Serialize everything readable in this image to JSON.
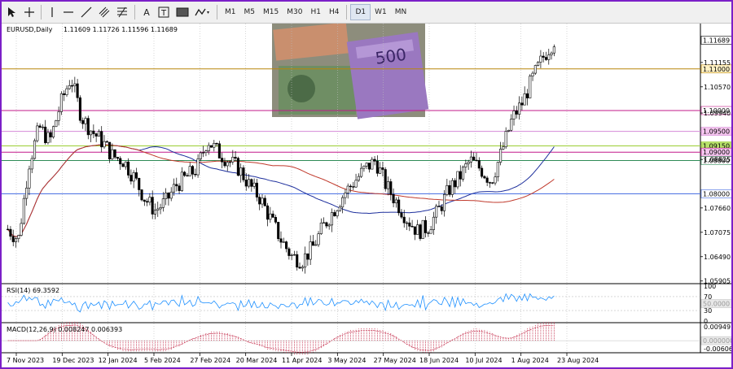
{
  "toolbar": {
    "timeframes": [
      "M1",
      "M5",
      "M15",
      "M30",
      "H1",
      "H4",
      "D1",
      "W1",
      "MN"
    ],
    "active_timeframe": "D1",
    "text_tool": "A",
    "text_label_tool": "T"
  },
  "chart_header": {
    "symbol": "EURUSD,Daily",
    "ohlc": "1.11609 1.11726 1.11596 1.11689"
  },
  "price_axis": {
    "ticks": [
      "1.11155",
      "1.10570",
      "1.09940",
      "1.08825",
      "1.07660",
      "1.07075",
      "1.06490",
      "1.05905"
    ],
    "current_price": "1.11689"
  },
  "levels": [
    {
      "label": "1.11000",
      "value": 1.11,
      "color": "#b8860b",
      "badge": "#fff1c4"
    },
    {
      "label": "1.10000",
      "value": 1.1,
      "color": "#c2188a",
      "badge": "#ffffff"
    },
    {
      "label": "1.09500",
      "value": 1.095,
      "color": "#d58ad8",
      "badge": "#f5c6ef"
    },
    {
      "label": "1.09150",
      "value": 1.0915,
      "color": "#9acd32",
      "badge": "#b6e06a"
    },
    {
      "label": "1.09000",
      "value": 1.09,
      "color": "#c2188a",
      "badge": "#f5c6ef"
    },
    {
      "label": "1.08800",
      "value": 1.088,
      "color": "#2e8b57",
      "badge": "#ffffff"
    },
    {
      "label": "1.08000",
      "value": 1.08,
      "color": "#4169e1",
      "badge": "#ffffff"
    }
  ],
  "date_axis": [
    "7 Nov 2023",
    "19 Dec 2023",
    "12 Jan 2024",
    "5 Feb 2024",
    "27 Feb 2024",
    "20 Mar 2024",
    "11 Apr 2024",
    "3 May 2024",
    "27 May 2024",
    "18 Jun 2024",
    "10 Jul 2024",
    "1 Aug 2024",
    "23 Aug 2024"
  ],
  "rsi": {
    "label": "RSI(14) 69.3592",
    "ticks": [
      "100",
      "70",
      "30",
      "0"
    ],
    "level_badge": "50.0000"
  },
  "macd": {
    "label": "MACD(12,26,9) 0.008247 0.006393",
    "ticks": [
      "0.009497",
      "-0.006067"
    ],
    "zero_badge": "0.000000"
  },
  "colors": {
    "up_candle": "#000000",
    "down_candle": "#000000",
    "ma_fast": "#1c2e9c",
    "ma_slow": "#c0392b",
    "rsi_line": "#1e90ff",
    "macd_hist": "#c02040",
    "frame": "#7b1fc8"
  },
  "chart_data": {
    "type": "candlestick",
    "title": "EURUSD,Daily",
    "ylim": [
      1.0588,
      1.1205
    ],
    "x_start": "7 Nov 2023",
    "x_end": "23 Aug 2024",
    "close_path": [
      1.0715,
      1.069,
      1.0872,
      1.096,
      1.0925,
      1.1015,
      1.108,
      1.0985,
      1.095,
      1.0925,
      1.089,
      1.088,
      1.084,
      1.079,
      1.076,
      1.078,
      1.082,
      1.084,
      1.086,
      1.093,
      1.09,
      1.088,
      1.086,
      1.082,
      1.079,
      1.074,
      1.069,
      1.065,
      1.064,
      1.067,
      1.072,
      1.076,
      1.08,
      1.083,
      1.086,
      1.088,
      1.082,
      1.078,
      1.074,
      1.071,
      1.072,
      1.076,
      1.081,
      1.084,
      1.088,
      1.086,
      1.083,
      1.09,
      1.098,
      1.102,
      1.108,
      1.113,
      1.1169
    ]
  }
}
